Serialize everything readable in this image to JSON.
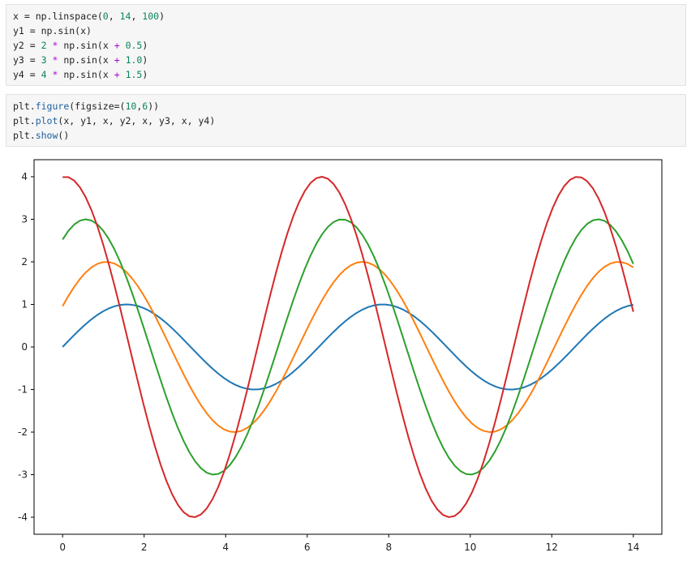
{
  "cells": [
    {
      "lines": [
        [
          {
            "t": "x = np.linspace(",
            "c": "id"
          },
          {
            "t": "0",
            "c": "num"
          },
          {
            "t": ", ",
            "c": "id"
          },
          {
            "t": "14",
            "c": "num"
          },
          {
            "t": ", ",
            "c": "id"
          },
          {
            "t": "100",
            "c": "num"
          },
          {
            "t": ")",
            "c": "id"
          }
        ],
        [
          {
            "t": "y1 = np.sin(x)",
            "c": "id"
          }
        ],
        [
          {
            "t": "y2 = ",
            "c": "id"
          },
          {
            "t": "2",
            "c": "num"
          },
          {
            "t": " ",
            "c": "id"
          },
          {
            "t": "*",
            "c": "op"
          },
          {
            "t": " np.sin(x ",
            "c": "id"
          },
          {
            "t": "+",
            "c": "op"
          },
          {
            "t": " ",
            "c": "id"
          },
          {
            "t": "0.5",
            "c": "num"
          },
          {
            "t": ")",
            "c": "id"
          }
        ],
        [
          {
            "t": "y3 = ",
            "c": "id"
          },
          {
            "t": "3",
            "c": "num"
          },
          {
            "t": " ",
            "c": "id"
          },
          {
            "t": "*",
            "c": "op"
          },
          {
            "t": " np.sin(x ",
            "c": "id"
          },
          {
            "t": "+",
            "c": "op"
          },
          {
            "t": " ",
            "c": "id"
          },
          {
            "t": "1.0",
            "c": "num"
          },
          {
            "t": ")",
            "c": "id"
          }
        ],
        [
          {
            "t": "y4 = ",
            "c": "id"
          },
          {
            "t": "4",
            "c": "num"
          },
          {
            "t": " ",
            "c": "id"
          },
          {
            "t": "*",
            "c": "op"
          },
          {
            "t": " np.sin(x ",
            "c": "id"
          },
          {
            "t": "+",
            "c": "op"
          },
          {
            "t": " ",
            "c": "id"
          },
          {
            "t": "1.5",
            "c": "num"
          },
          {
            "t": ")",
            "c": "id"
          }
        ]
      ]
    },
    {
      "lines": [
        [
          {
            "t": "plt.",
            "c": "id"
          },
          {
            "t": "figure",
            "c": "fn"
          },
          {
            "t": "(figsize=(",
            "c": "id"
          },
          {
            "t": "10",
            "c": "num"
          },
          {
            "t": ",",
            "c": "id"
          },
          {
            "t": "6",
            "c": "num"
          },
          {
            "t": "))",
            "c": "id"
          }
        ],
        [
          {
            "t": "plt.",
            "c": "id"
          },
          {
            "t": "plot",
            "c": "fn"
          },
          {
            "t": "(x, y1, x, y2, x, y3, x, y4)",
            "c": "id"
          }
        ],
        [
          {
            "t": "plt.",
            "c": "id"
          },
          {
            "t": "show",
            "c": "fn"
          },
          {
            "t": "()",
            "c": "id"
          }
        ]
      ]
    }
  ],
  "colors": {
    "num": "#098658",
    "op": "#af00db",
    "fn": "#1f5fa0",
    "id": "#1f1f1f"
  },
  "chart_data": {
    "type": "line",
    "title": "",
    "xlabel": "",
    "ylabel": "",
    "xlim": [
      -0.7,
      14.7
    ],
    "ylim": [
      -4.4,
      4.4
    ],
    "xticks": [
      0,
      2,
      4,
      6,
      8,
      10,
      12,
      14
    ],
    "xtick_labels": [
      "0",
      "2",
      "4",
      "6",
      "8",
      "10",
      "12",
      "14"
    ],
    "yticks": [
      -4,
      -3,
      -2,
      -1,
      0,
      1,
      2,
      3,
      4
    ],
    "ytick_labels": [
      "-4",
      "-3",
      "-2",
      "-1",
      "0",
      "1",
      "2",
      "3",
      "4"
    ],
    "grid": false,
    "legend": "none",
    "x": {
      "start": 0,
      "end": 14,
      "num_points": 100
    },
    "series": [
      {
        "amplitude": 1,
        "phase": 0.0,
        "color": "#1f77b4"
      },
      {
        "amplitude": 2,
        "phase": 0.5,
        "color": "#ff7f0e"
      },
      {
        "amplitude": 3,
        "phase": 1.0,
        "color": "#2ca02c"
      },
      {
        "amplitude": 4,
        "phase": 1.5,
        "color": "#d62728"
      }
    ]
  }
}
